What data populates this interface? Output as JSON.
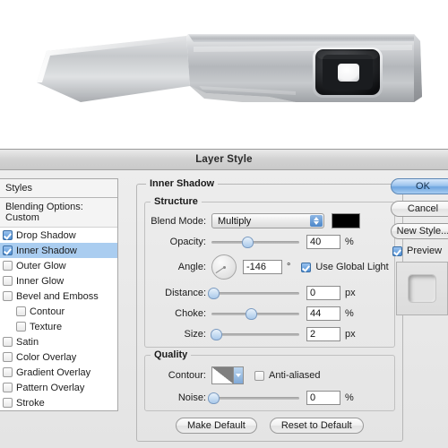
{
  "window": {
    "title": "Layer Style"
  },
  "artwork": {
    "name": "metallic-device-render",
    "description": "Brushed aluminium angled bracket with dark rectangular lens module"
  },
  "styles_panel": {
    "header": "Styles",
    "blending_options": "Blending Options: Custom",
    "items": [
      {
        "label": "Drop Shadow",
        "checked": true,
        "selected": false,
        "indent": false
      },
      {
        "label": "Inner Shadow",
        "checked": true,
        "selected": true,
        "indent": false
      },
      {
        "label": "Outer Glow",
        "checked": false,
        "selected": false,
        "indent": false
      },
      {
        "label": "Inner Glow",
        "checked": false,
        "selected": false,
        "indent": false
      },
      {
        "label": "Bevel and Emboss",
        "checked": false,
        "selected": false,
        "indent": false
      },
      {
        "label": "Contour",
        "checked": false,
        "selected": false,
        "indent": true
      },
      {
        "label": "Texture",
        "checked": false,
        "selected": false,
        "indent": true
      },
      {
        "label": "Satin",
        "checked": false,
        "selected": false,
        "indent": false
      },
      {
        "label": "Color Overlay",
        "checked": false,
        "selected": false,
        "indent": false
      },
      {
        "label": "Gradient Overlay",
        "checked": false,
        "selected": false,
        "indent": false
      },
      {
        "label": "Pattern Overlay",
        "checked": false,
        "selected": false,
        "indent": false
      },
      {
        "label": "Stroke",
        "checked": false,
        "selected": false,
        "indent": false
      }
    ]
  },
  "inner_shadow": {
    "group_label": "Inner Shadow",
    "structure": {
      "label": "Structure",
      "blend_mode": {
        "label": "Blend Mode:",
        "value": "Multiply",
        "color": "#000000"
      },
      "opacity": {
        "label": "Opacity:",
        "value": "40",
        "unit": "%",
        "percent": 40
      },
      "angle": {
        "label": "Angle:",
        "value": "-146",
        "unit": "°",
        "degrees": -146
      },
      "use_global_light": {
        "label": "Use Global Light",
        "checked": true
      },
      "distance": {
        "label": "Distance:",
        "value": "0",
        "unit": "px",
        "percent": 0
      },
      "choke": {
        "label": "Choke:",
        "value": "44",
        "unit": "%",
        "percent": 44
      },
      "size": {
        "label": "Size:",
        "value": "2",
        "unit": "px",
        "percent": 4
      }
    },
    "quality": {
      "label": "Quality",
      "contour": {
        "label": "Contour:",
        "shape": "linear-contour"
      },
      "anti_aliased": {
        "label": "Anti-aliased",
        "checked": false
      },
      "noise": {
        "label": "Noise:",
        "value": "0",
        "unit": "%",
        "percent": 0
      }
    },
    "buttons": {
      "make_default": "Make Default",
      "reset_to_default": "Reset to Default"
    }
  },
  "actions": {
    "ok": "OK",
    "cancel": "Cancel",
    "new_style": "New Style...",
    "preview": {
      "label": "Preview",
      "checked": true
    }
  },
  "colors": {
    "selection_blue": "#aacdf0",
    "accent_blue": "#4b86c9",
    "dialog_bg": "#ebebeb",
    "swatch_black": "#000000"
  }
}
